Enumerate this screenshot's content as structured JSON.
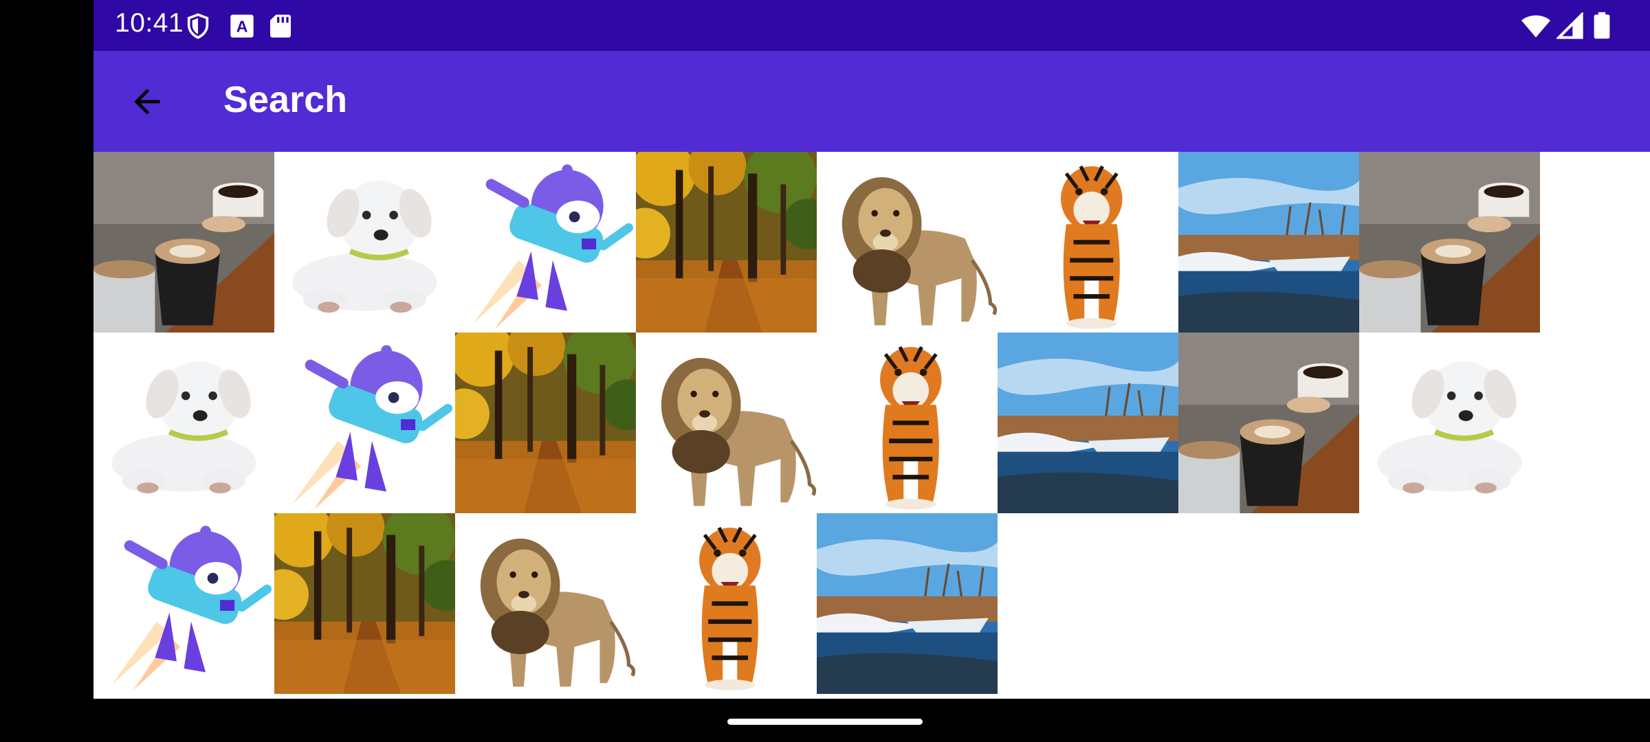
{
  "status_bar": {
    "time": "10:41",
    "left_icons": [
      "shield-icon",
      "font-a-icon",
      "sd-card-icon"
    ],
    "right_icons": [
      "wifi-icon",
      "signal-icon",
      "battery-icon"
    ],
    "background": "#3008A5"
  },
  "app_bar": {
    "title": "Search",
    "back_icon": "arrow-back-icon",
    "background": "#512BD4"
  },
  "grid": {
    "columns": 8,
    "rows": [
      [
        "coffee",
        "puppy",
        "dotnet-bot",
        "forest",
        "lion",
        "tiger",
        "river",
        "coffee"
      ],
      [
        "puppy",
        "dotnet-bot",
        "forest",
        "lion",
        "tiger",
        "river",
        "coffee",
        "puppy"
      ],
      [
        "dotnet-bot",
        "forest",
        "lion",
        "tiger",
        "river"
      ]
    ]
  },
  "colors": {
    "accent": "#512BD4",
    "status": "#3008A5"
  }
}
